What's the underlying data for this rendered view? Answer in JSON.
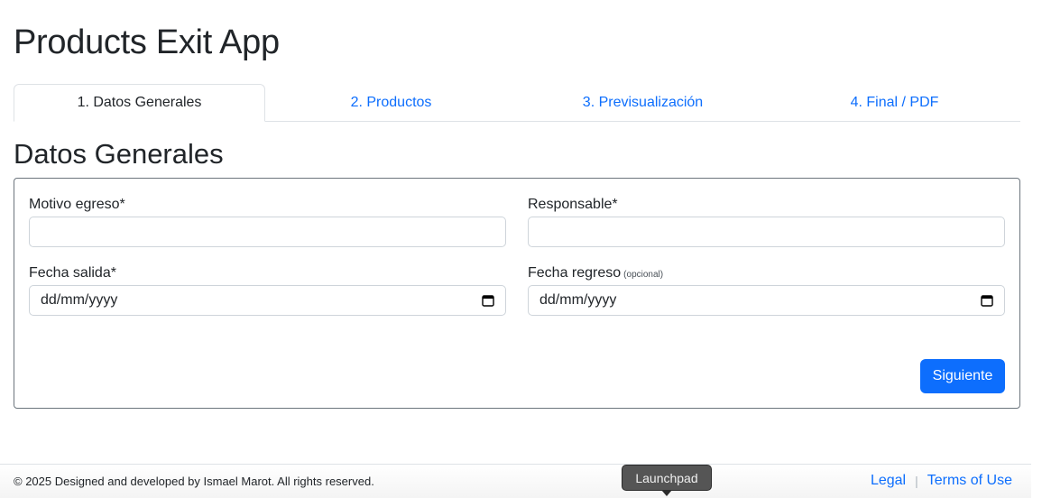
{
  "app": {
    "title": "Products Exit App"
  },
  "tabs": [
    {
      "label": "1. Datos Generales",
      "active": true
    },
    {
      "label": "2. Productos",
      "active": false
    },
    {
      "label": "3. Previsualización",
      "active": false
    },
    {
      "label": "4. Final / PDF",
      "active": false
    }
  ],
  "section": {
    "title": "Datos Generales"
  },
  "form": {
    "motivo": {
      "label": "Motivo egreso*",
      "value": ""
    },
    "responsable": {
      "label": "Responsable*",
      "value": ""
    },
    "fecha_salida": {
      "label": "Fecha salida*",
      "placeholder": "dd/mm/yyyy"
    },
    "fecha_regreso": {
      "label": "Fecha regreso",
      "hint": "(opcional)",
      "placeholder": "dd/mm/yyyy"
    },
    "next_label": "Siguiente"
  },
  "footer": {
    "copyright": "© 2025 Designed and developed by Ismael Marot. All rights reserved.",
    "legal": "Legal",
    "separator": "|",
    "terms": "Terms of Use"
  },
  "tooltip": {
    "text": "Launchpad"
  },
  "colors": {
    "accent": "#0d6efd",
    "text": "#212529",
    "border": "#dee2e6"
  }
}
